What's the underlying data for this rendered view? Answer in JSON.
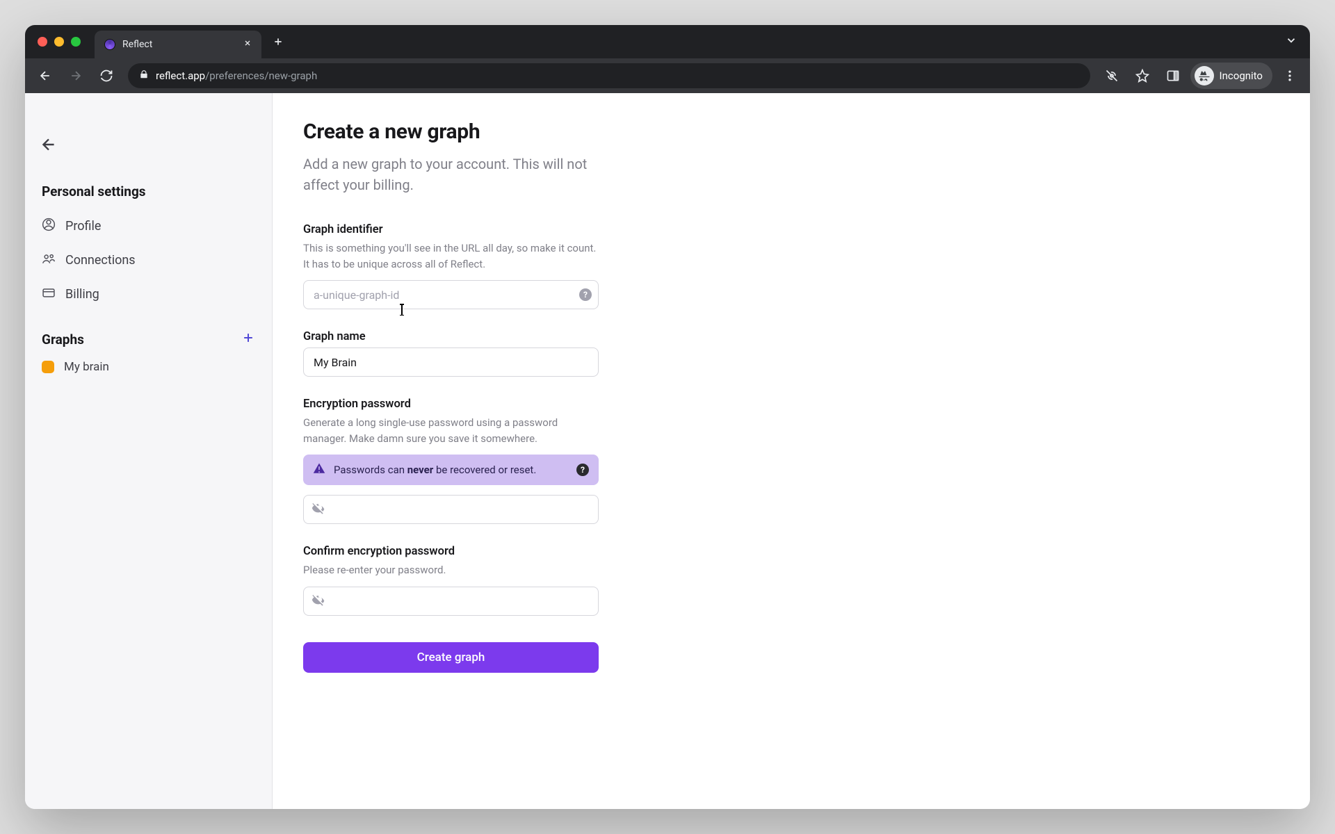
{
  "browser": {
    "tab_title": "Reflect",
    "url_domain": "reflect.app",
    "url_path": "/preferences/new-graph",
    "incognito_label": "Incognito"
  },
  "sidebar": {
    "section_personal": "Personal settings",
    "items": {
      "profile": "Profile",
      "connections": "Connections",
      "billing": "Billing"
    },
    "section_graphs": "Graphs",
    "graphs": [
      {
        "name": "My brain",
        "color": "#f59e0b"
      }
    ]
  },
  "form": {
    "title": "Create a new graph",
    "subtitle": "Add a new graph to your account. This will not affect your billing.",
    "identifier": {
      "label": "Graph identifier",
      "help": "This is something you'll see in the URL all day, so make it count. It has to be unique across all of Reflect.",
      "placeholder": "a-unique-graph-id",
      "value": ""
    },
    "name": {
      "label": "Graph name",
      "value": "My Brain"
    },
    "password": {
      "label": "Encryption password",
      "help": "Generate a long single-use password using a password manager. Make damn sure you save it somewhere.",
      "warning_prefix": "Passwords can ",
      "warning_bold": "never",
      "warning_suffix": " be recovered or reset.",
      "value": ""
    },
    "confirm": {
      "label": "Confirm encryption password",
      "help": "Please re-enter your password.",
      "value": ""
    },
    "submit_label": "Create graph"
  }
}
